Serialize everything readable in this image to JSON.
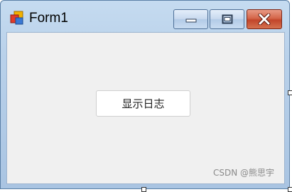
{
  "window": {
    "title": "Form1",
    "icon": "winforms-app-icon",
    "controls": {
      "minimize_icon": "minimize-icon",
      "maximize_icon": "maximize-icon",
      "close_icon": "close-icon"
    }
  },
  "form": {
    "button_label": "显示日志",
    "background_color": "#f0f0f0"
  },
  "watermark": {
    "text": "CSDN @熊思宇"
  },
  "colors": {
    "close_button": "#c2452a",
    "titlebar": "#b9d1ea"
  }
}
